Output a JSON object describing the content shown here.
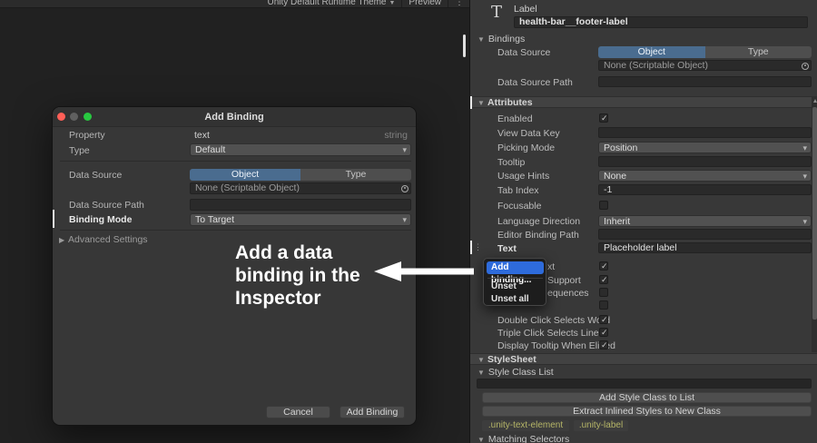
{
  "colors": {
    "accent_blue": "#2e6bdb",
    "tab_selected_blue": "#4a6c8f",
    "canvas": "#212121",
    "panel": "#383838"
  },
  "toolbar": {
    "theme_label": "Unity Default Runtime Theme",
    "preview_label": "Preview",
    "kebab_icon": "⋮"
  },
  "dialog": {
    "title": "Add Binding",
    "property_label": "Property",
    "property_value": "text",
    "property_type": "string",
    "type_label": "Type",
    "type_value": "Default",
    "data_source_label": "Data Source",
    "object_tab": "Object",
    "type_tab": "Type",
    "object_field_placeholder": "None (Scriptable Object)",
    "data_source_path_label": "Data Source Path",
    "binding_mode_label": "Binding Mode",
    "binding_mode_value": "To Target",
    "advanced_settings_label": "Advanced Settings",
    "cancel_label": "Cancel",
    "add_binding_label": "Add Binding",
    "annotation_line1": "Add a data",
    "annotation_line2": "binding in the",
    "annotation_line3": "Inspector"
  },
  "inspector": {
    "element_icon_glyph": "T",
    "type_label": "Label",
    "name_value": "health-bar__footer-label",
    "bindings_section": "Bindings",
    "data_source_label": "Data Source",
    "object_tab": "Object",
    "type_tab": "Type",
    "object_field_placeholder": "None (Scriptable Object)",
    "data_source_path_label": "Data Source Path",
    "attributes_section": "Attributes",
    "drag_handle_icon": "⋮",
    "attr_rows": [
      {
        "label": "Enabled",
        "check": "✓"
      },
      {
        "label": "View Data Key",
        "value": ""
      },
      {
        "label": "Picking Mode",
        "value": "Position"
      },
      {
        "label": "Tooltip",
        "value": ""
      },
      {
        "label": "Usage Hints",
        "value": "None"
      },
      {
        "label": "Tab Index",
        "value": "-1"
      },
      {
        "label": "Focusable",
        "check": ""
      },
      {
        "label": "Language Direction",
        "value": "Inherit"
      },
      {
        "label": "Editor Binding Path",
        "value": ""
      },
      {
        "label": "Text",
        "value": "Placeholder label"
      },
      {
        "label": "xt",
        "check": "✓"
      },
      {
        "label": "Support",
        "check": "✓"
      },
      {
        "label": "equences",
        "check": ""
      },
      {
        "label": "",
        "check": ""
      },
      {
        "label": "Double Click Selects Word",
        "check": "✓"
      },
      {
        "label": "Triple Click Selects Line",
        "check": "✓"
      },
      {
        "label": "Display Tooltip When Elided",
        "check": "✓"
      }
    ],
    "context_menu": {
      "add_binding": "Add binding...",
      "unset": "Unset",
      "unset_all": "Unset all"
    },
    "stylesheet_section": "StyleSheet",
    "style_class_list_section": "Style Class List",
    "style_class_input": "",
    "add_style_class_button": "Add Style Class to List",
    "extract_styles_button": "Extract Inlined Styles to New Class",
    "class_pills": [
      ".unity-text-element",
      ".unity-label"
    ],
    "matching_selectors_section": "Matching Selectors"
  }
}
